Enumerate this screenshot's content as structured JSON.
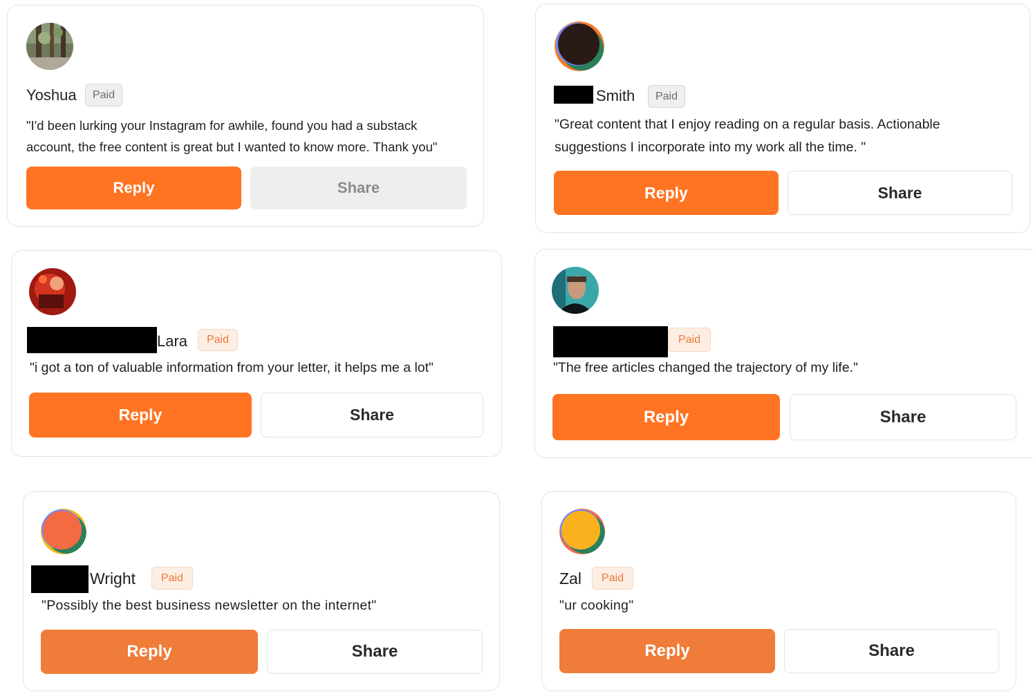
{
  "badge_label": "Paid",
  "reply_label": "Reply",
  "share_label": "Share",
  "cards": [
    {
      "name": "Yoshua",
      "quote": "\"I'd been lurking your Instagram for awhile, found you had a substack account, the free content is great but I wanted to know more. Thank you\"",
      "avatar": "forest-photo"
    },
    {
      "name": "Smith",
      "quote": "\"Great content that I enjoy reading on a regular basis. Actionable suggestions I incorporate into my work all the time. \"",
      "avatar": "dark-disc"
    },
    {
      "name": "Lara",
      "quote": "\"i got a ton of valuable information from your letter, it helps me a lot\"",
      "avatar": "red-photo"
    },
    {
      "name": "",
      "quote": "\"The free articles changed the trajectory of my life.\"",
      "avatar": "man-portrait"
    },
    {
      "name": "Wright",
      "quote": "\"Possibly the best business newsletter on the internet\"",
      "avatar": "orange-disc"
    },
    {
      "name": "Zal",
      "quote": "\"ur cooking\"",
      "avatar": "yellow-disc"
    }
  ],
  "colors": {
    "accent": "#ff7422",
    "badge_orange_text": "#ee7836",
    "badge_gray_text": "#6d6d6d"
  }
}
